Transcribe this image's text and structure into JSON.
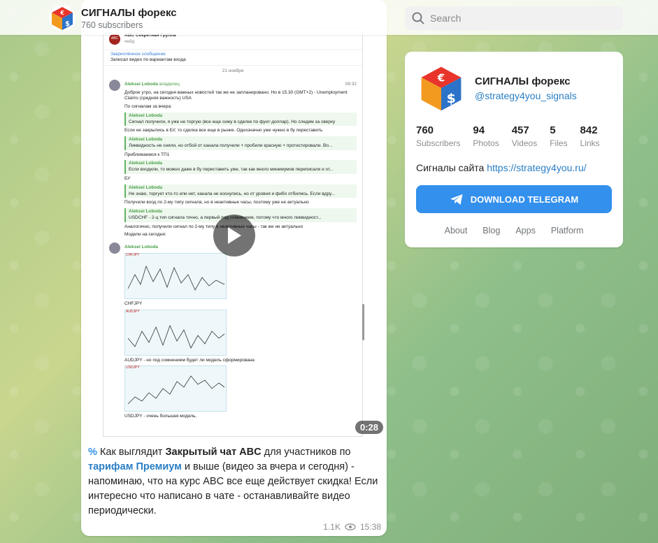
{
  "header": {
    "channel_title": "СИГНАЛЫ форекс",
    "subscribers": "760 subscribers",
    "search_placeholder": "Search"
  },
  "video": {
    "duration": "0:28",
    "doc": {
      "group_name": "ABC Секретная Группа",
      "group_sub": "чейд",
      "pinned_label": "Закреплённое сообщение",
      "pinned_text": "Записал видео по вариантам входа",
      "date": "21 ноября",
      "author": "Aleksei Loboda",
      "author_role": "владелец",
      "msg1": "Доброе утро, на сегодня важных новостей так же не запланировано. Но в 15.30 (GMT+2) - Unemployment Claims (средняя важность) USA",
      "msg1_time": "09:32",
      "msg2": "По сигналам за вчера:",
      "q1": "Сигнал получили, я уже не торгую (все еще сижу в сделке по фунт-доллар). Но следим за сверху",
      "msg3": "Если не закрылись в БУ, то сделка все еще в рынке. Однозначно уже нужно в бу переставить",
      "q2": "Ликвидность не сняли, но отбой от канала получили + пробили красную + протестировали. Во...",
      "msg4": "Приближаемся к ТП1",
      "q3": "Если входили, то можно даже в бу переставить уже, так как много минимумов переписали и от...",
      "msg5": "БУ",
      "q4": "Не знаю, торгует кто-то или нет, канала не коснулись, но от уровня и фибо отбились. Если вдру...",
      "msg6": "Получили вход по 2-му типу сигнала, но в неактивные часы, поэтому уже не актуально",
      "q5": "USDCHF - 2-ц тип сигнала точно, а первый под сомнением, потому что много ликвидност...",
      "msg7": "Аналогично, получили сигнал по 2-му типу в неактивные часы - так же не актуально",
      "msg8": "Модели на сегодня:",
      "chart1": "CHFJPY",
      "chart1_caption": "CHFJPY",
      "chart2": "AUDJPY",
      "chart2_caption": "AUDJPY - но под сомнением будет ли модель сформирована",
      "chart3": "USDJPY",
      "chart3_caption": "USDJPY - очень большая модель,"
    }
  },
  "caption": {
    "part1": "Как выглядит ",
    "bold1": "Закрытый чат ABC",
    "part2": " для участников по ",
    "link1": "тарифам Премиум",
    "part3": " и выше (видео за вчера и сегодня) - напоминаю, что на курс ABC все еще действует скидка! Если интересно что написано в чате - останавливайте видео периодически."
  },
  "post_meta": {
    "views": "1.1K",
    "time": "15:38"
  },
  "info": {
    "name": "СИГНАЛЫ форекс",
    "handle": "@strategy4you_signals",
    "stats": [
      {
        "n": "760",
        "l": "Subscribers"
      },
      {
        "n": "94",
        "l": "Photos"
      },
      {
        "n": "457",
        "l": "Videos"
      },
      {
        "n": "5",
        "l": "Files"
      },
      {
        "n": "842",
        "l": "Links"
      }
    ],
    "desc_text": "Сигналы сайта ",
    "desc_link": "https://strategy4you.ru/",
    "download_label": "DOWNLOAD TELEGRAM",
    "links": [
      "About",
      "Blog",
      "Apps",
      "Platform"
    ]
  },
  "colors": {
    "accent": "#3390ec",
    "link": "#2a7ec5"
  }
}
